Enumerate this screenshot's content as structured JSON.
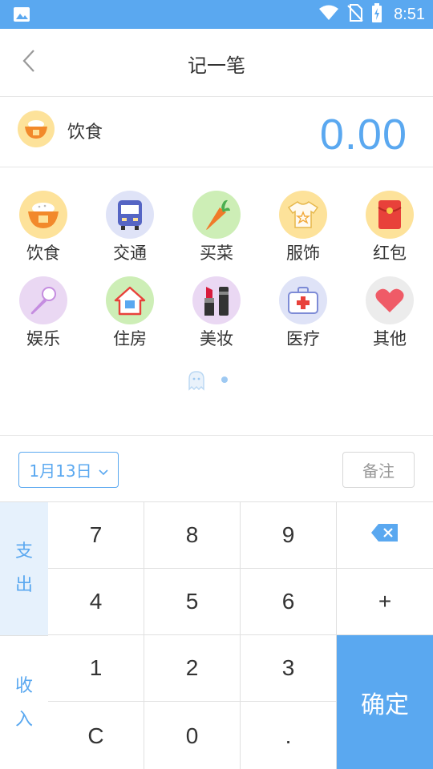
{
  "status_bar": {
    "time": "8:51"
  },
  "header": {
    "title": "记一笔"
  },
  "selected": {
    "name": "饮食",
    "amount": "0.00",
    "icon": "rice-bowl-icon"
  },
  "categories": [
    {
      "label": "饮食",
      "icon": "rice-bowl-icon",
      "bg": "#fde29a"
    },
    {
      "label": "交通",
      "icon": "bus-icon",
      "bg": "#dfe3f7"
    },
    {
      "label": "买菜",
      "icon": "carrot-icon",
      "bg": "#cdeeb6"
    },
    {
      "label": "服饰",
      "icon": "shirt-icon",
      "bg": "#fde29a"
    },
    {
      "label": "红包",
      "icon": "red-envelope-icon",
      "bg": "#fde29a"
    },
    {
      "label": "娱乐",
      "icon": "microphone-icon",
      "bg": "#ead8f3"
    },
    {
      "label": "住房",
      "icon": "house-icon",
      "bg": "#cdeeb6"
    },
    {
      "label": "美妆",
      "icon": "lipstick-icon",
      "bg": "#ead8f3"
    },
    {
      "label": "医疗",
      "icon": "first-aid-kit-icon",
      "bg": "#dfe3f7"
    },
    {
      "label": "其他",
      "icon": "heart-icon",
      "bg": "#ececec"
    }
  ],
  "date": {
    "label": "1月13日"
  },
  "note": {
    "label": "备注"
  },
  "type_toggle": {
    "expense": [
      "支",
      "出"
    ],
    "income": [
      "收",
      "入"
    ]
  },
  "keys": {
    "k7": "7",
    "k8": "8",
    "k9": "9",
    "k4": "4",
    "k5": "5",
    "k6": "6",
    "plus": "+",
    "k1": "1",
    "k2": "2",
    "k3": "3",
    "clear": "C",
    "k0": "0",
    "dot": "."
  },
  "confirm_label": "确定",
  "colors": {
    "accent": "#5aa8f0",
    "active_bg": "#e6f1fc"
  }
}
